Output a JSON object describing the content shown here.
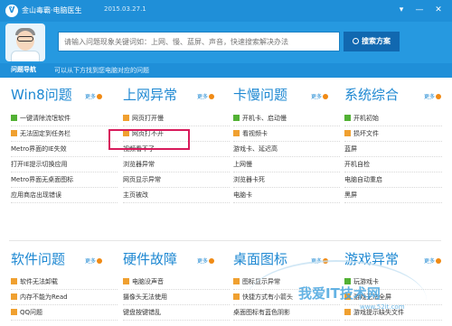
{
  "titlebar": {
    "app_title": "金山毒霸·电脑医生",
    "version": "2015.03.27.1",
    "controls": [
      "▾",
      "—",
      "✕"
    ]
  },
  "search": {
    "placeholder": "请输入问题现象关键词如：上网、慢、蓝屏、声音，快速搜索解决办法",
    "button_label": "搜索方案"
  },
  "nav": {
    "tab": "问题导航",
    "hint": "可以从下方找到您电脑对应的问题"
  },
  "more_label": "更多",
  "columns_top": [
    {
      "title": "Win8问题",
      "items": [
        {
          "label": "一键清除流氓软件",
          "badge": "green"
        },
        {
          "label": "无法固定到任务栏",
          "badge": "orange"
        },
        {
          "label": "Metro界面的IE失效",
          "badge": ""
        },
        {
          "label": "打开IE提示切换应用",
          "badge": ""
        },
        {
          "label": "Metro界面无桌面图标",
          "badge": ""
        },
        {
          "label": "应用商店出现错误",
          "badge": ""
        }
      ]
    },
    {
      "title": "上网异常",
      "items": [
        {
          "label": "网页打开慢",
          "badge": "orange"
        },
        {
          "label": "网页打不开",
          "badge": "orange"
        },
        {
          "label": "视频看不了",
          "badge": ""
        },
        {
          "label": "浏览器异常",
          "badge": ""
        },
        {
          "label": "网页显示异常",
          "badge": ""
        },
        {
          "label": "主页被改",
          "badge": ""
        }
      ]
    },
    {
      "title": "卡慢问题",
      "items": [
        {
          "label": "开机卡、启动慢",
          "badge": "green"
        },
        {
          "label": "看视频卡",
          "badge": "orange"
        },
        {
          "label": "游戏卡、延迟高",
          "badge": ""
        },
        {
          "label": "上网慢",
          "badge": ""
        },
        {
          "label": "浏览器卡死",
          "badge": ""
        },
        {
          "label": "电脑卡",
          "badge": ""
        }
      ]
    },
    {
      "title": "系统综合",
      "items": [
        {
          "label": "开机初始",
          "badge": "green"
        },
        {
          "label": "损坏文件",
          "badge": "orange"
        },
        {
          "label": "蓝屏",
          "badge": ""
        },
        {
          "label": "开机自检",
          "badge": ""
        },
        {
          "label": "电脑自动重启",
          "badge": ""
        },
        {
          "label": "黑屏",
          "badge": ""
        }
      ]
    }
  ],
  "columns_bottom": [
    {
      "title": "软件问题",
      "items": [
        {
          "label": "软件无法卸载",
          "badge": "orange"
        },
        {
          "label": "内存不能为Read",
          "badge": "orange"
        },
        {
          "label": "QQ问题",
          "badge": "orange"
        }
      ]
    },
    {
      "title": "硬件故障",
      "items": [
        {
          "label": "电脑没声音",
          "badge": "orange"
        },
        {
          "label": "摄像头无法使用",
          "badge": ""
        },
        {
          "label": "键盘按键错乱",
          "badge": ""
        }
      ]
    },
    {
      "title": "桌面图标",
      "items": [
        {
          "label": "图标显示异常",
          "badge": "orange"
        },
        {
          "label": "快捷方式有小箭头",
          "badge": "orange"
        },
        {
          "label": "桌面图标有蓝色阴影",
          "badge": ""
        }
      ]
    },
    {
      "title": "游戏异常",
      "items": [
        {
          "label": "玩游戏卡",
          "badge": "green"
        },
        {
          "label": "游戏无法全屏",
          "badge": "orange"
        },
        {
          "label": "游戏提示缺失文件",
          "badge": "orange"
        }
      ]
    }
  ],
  "watermark": {
    "text": "我爱IT技术网",
    "sub": "www.52it.com"
  }
}
